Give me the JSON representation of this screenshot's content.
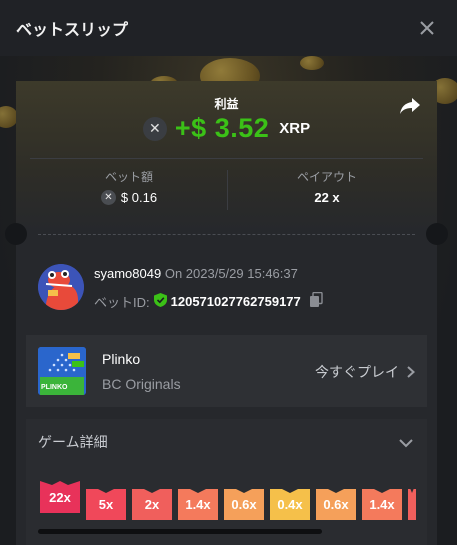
{
  "header": {
    "title": "ベットスリップ",
    "close_icon": "close-icon"
  },
  "result": {
    "profit_label": "利益",
    "profit_amount": "+$ 3.52",
    "currency": "XRP",
    "accent_color": "#3bc117"
  },
  "stats": {
    "bet_label": "ベット額",
    "bet_value": "$ 0.16",
    "payout_label": "ペイアウト",
    "payout_value": "22 x"
  },
  "user": {
    "name": "syamo8049",
    "on_text": "On 2023/5/29 15:46:37",
    "bet_id_label": "ベットID:",
    "bet_id": "120571027762759177"
  },
  "game": {
    "name": "Plinko",
    "provider": "BC Originals",
    "play_label": "今すぐプレイ",
    "thumb_label": "PLINKO"
  },
  "details": {
    "heading": "ゲーム詳細",
    "multipliers": [
      {
        "label": "22x",
        "color": "#e8325a"
      },
      {
        "label": "5x",
        "color": "#f0485a"
      },
      {
        "label": "2x",
        "color": "#f05f5c"
      },
      {
        "label": "1.4x",
        "color": "#f47a5c"
      },
      {
        "label": "0.6x",
        "color": "#f5a05a"
      },
      {
        "label": "0.4x",
        "color": "#f5c04a"
      },
      {
        "label": "0.6x",
        "color": "#f5a05a"
      },
      {
        "label": "1.4x",
        "color": "#f47a5c"
      },
      {
        "label": "",
        "color": "#f05f5c"
      }
    ]
  }
}
